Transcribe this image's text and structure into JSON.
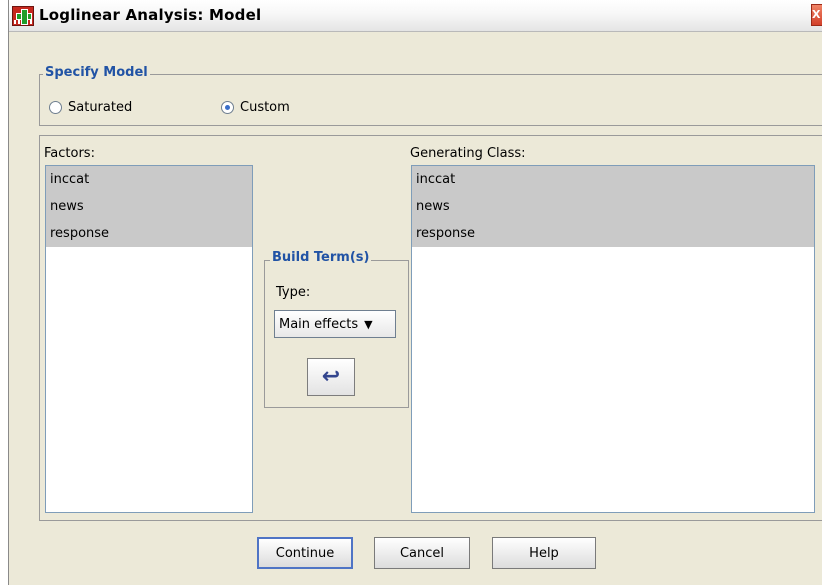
{
  "window": {
    "title": "Loglinear Analysis: Model",
    "close_glyph": "X"
  },
  "specify_model": {
    "legend": "Specify Model",
    "options": [
      {
        "label": "Saturated",
        "selected": false
      },
      {
        "label": "Custom",
        "selected": true
      }
    ]
  },
  "factors": {
    "label": "Factors:",
    "items": [
      "inccat",
      "news",
      "response"
    ]
  },
  "generating_class": {
    "label": "Generating Class:",
    "items": [
      "inccat",
      "news",
      "response"
    ]
  },
  "build_terms": {
    "legend": "Build Term(s)",
    "type_label": "Type:",
    "type_value": "Main effects",
    "move_icon": "arrow-left-icon"
  },
  "buttons": {
    "continue": "Continue",
    "cancel": "Cancel",
    "help": "Help"
  },
  "colors": {
    "accent": "#2153a5",
    "selection": "#c9c9c9",
    "dialog_bg": "#ece9d8"
  }
}
